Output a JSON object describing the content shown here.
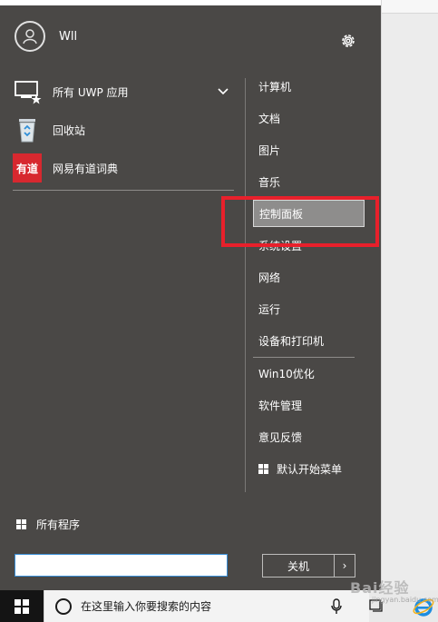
{
  "user": {
    "name": "Wll",
    "avatar_icon": "user-avatar-icon"
  },
  "apps": [
    {
      "label": "所有 UWP 应用",
      "icon": "uwp-apps-icon",
      "has_chevron": true
    },
    {
      "label": "回收站",
      "icon": "recycle-bin-icon"
    },
    {
      "label": "网易有道词典",
      "icon": "youdao-dict-icon",
      "icon_text": "有道"
    }
  ],
  "right_menu": {
    "group1": [
      "计算机",
      "文档",
      "图片",
      "音乐",
      "控制面板",
      "系统设置",
      "网络",
      "运行",
      "设备和打印机"
    ],
    "selected": "控制面板",
    "group2": [
      "Win10优化",
      "软件管理",
      "意见反馈"
    ],
    "default_start_menu": "默认开始菜单"
  },
  "all_programs": "所有程序",
  "search": {
    "value": ""
  },
  "shutdown": {
    "label": "关机",
    "arrow": "›"
  },
  "taskbar": {
    "search_placeholder": "在这里输入你要搜索的内容"
  },
  "watermark": {
    "text": "Bai经验",
    "sub": "jingyan.baidu.com"
  },
  "colors": {
    "menu_bg": "#4a4846",
    "highlight": "#e8202b",
    "selected_bg": "#8e8d8c",
    "youdao_red": "#d7282f"
  }
}
